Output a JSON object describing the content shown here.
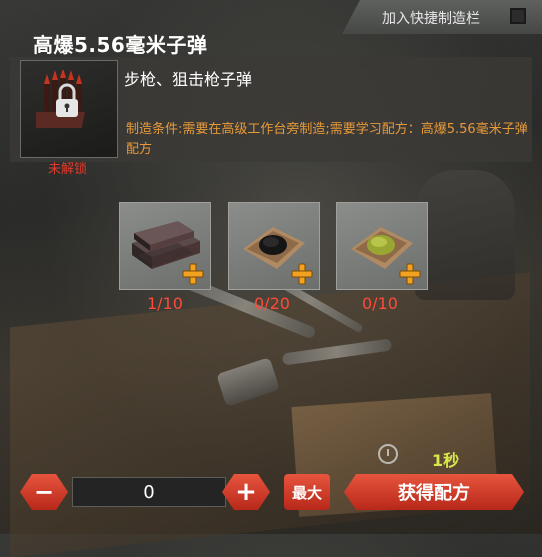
{
  "quickcraft": {
    "label": "加入快捷制造栏"
  },
  "title": "高爆5.56毫米子弹",
  "item": {
    "icon": "locked-ammo-box-icon",
    "lock_status": "未解锁"
  },
  "recipe": {
    "name": "步枪、狙击枪子弹",
    "condition": "制造条件:需要在高级工作台旁制造;需要学习配方：高爆5.56毫米子弹配方"
  },
  "materials": [
    {
      "icon": "metal-ingot-icon",
      "count": "1/10"
    },
    {
      "icon": "black-powder-icon",
      "count": "0/20"
    },
    {
      "icon": "yellow-powder-icon",
      "count": "0/10"
    }
  ],
  "craft": {
    "time": "1秒",
    "quantity": "0",
    "minus_label": "−",
    "plus_label": "+",
    "max_label": "最大",
    "get_recipe_label": "获得配方"
  },
  "colors": {
    "accent": "#d9432f",
    "warning": "#e69a3a",
    "lock": "#e03a2c",
    "time": "#d8e84a"
  }
}
